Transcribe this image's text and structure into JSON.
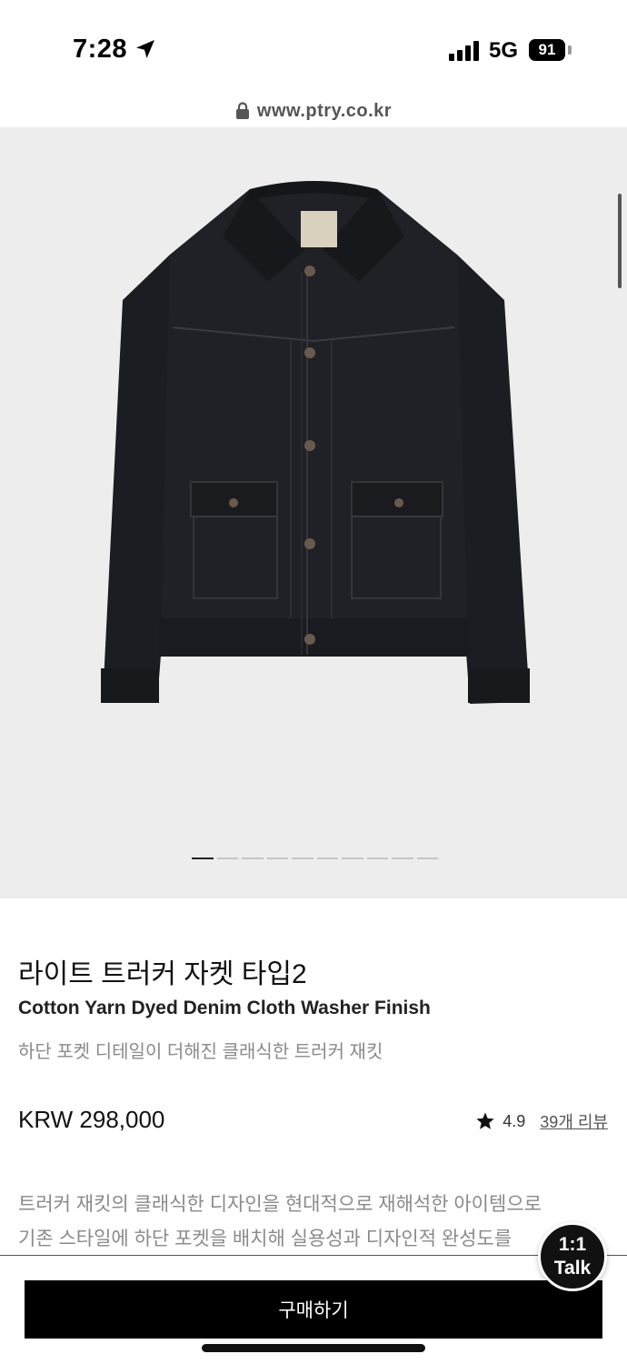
{
  "status_bar": {
    "time": "7:28",
    "network": "5G",
    "battery": "91"
  },
  "browser": {
    "url": "www.ptry.co.kr"
  },
  "carousel": {
    "total": 10,
    "active_index": 0
  },
  "product": {
    "title": "라이트 트러커 자켓 타입2",
    "subtitle": "Cotton Yarn Dyed Denim Cloth Washer Finish",
    "short_description": "하단 포켓 디테일이 더해진 클래식한 트러커 재킷",
    "price": "KRW 298,000",
    "rating": "4.9",
    "review_link": "39개 리뷰",
    "description_lines": [
      "트러커 재킷의 클래식한 디자인을 현대적으로 재해석한 아이템으로",
      "기존 스타일에 하단 포켓을 배치해 실용성과 디자인적 완성도를"
    ]
  },
  "actions": {
    "buy_label": "구매하기",
    "talk_line1": "1:1",
    "talk_line2": "Talk"
  },
  "icons": {
    "location": "location-arrow-icon",
    "signal": "signal-bars-icon",
    "lock": "lock-icon",
    "star": "star-icon"
  }
}
